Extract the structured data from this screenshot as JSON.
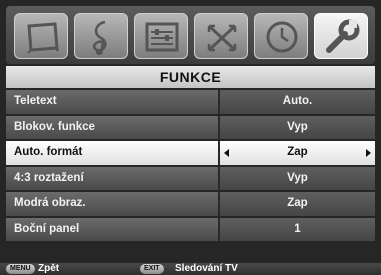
{
  "menu": {
    "title": "FUNKCE",
    "icons": [
      {
        "name": "picture-icon",
        "active": false
      },
      {
        "name": "sound-icon",
        "active": false
      },
      {
        "name": "setup-icon",
        "active": false
      },
      {
        "name": "connections-icon",
        "active": false
      },
      {
        "name": "timer-icon",
        "active": false
      },
      {
        "name": "features-wrench-icon",
        "active": true
      }
    ],
    "rows": [
      {
        "label": "Teletext",
        "value": "Auto.",
        "selected": false
      },
      {
        "label": "Blokov. funkce",
        "value": "Vyp",
        "selected": false
      },
      {
        "label": "Auto. formát",
        "value": "Zap",
        "selected": true
      },
      {
        "label": "4:3 roztažení",
        "value": "Vyp",
        "selected": false
      },
      {
        "label": "Modrá obraz.",
        "value": "Zap",
        "selected": false
      },
      {
        "label": "Boční panel",
        "value": "1",
        "selected": false
      }
    ]
  },
  "help": {
    "menu_key": "MENU",
    "menu_text": "Zpět",
    "exit_key": "EXIT",
    "exit_text": "Sledování TV"
  }
}
